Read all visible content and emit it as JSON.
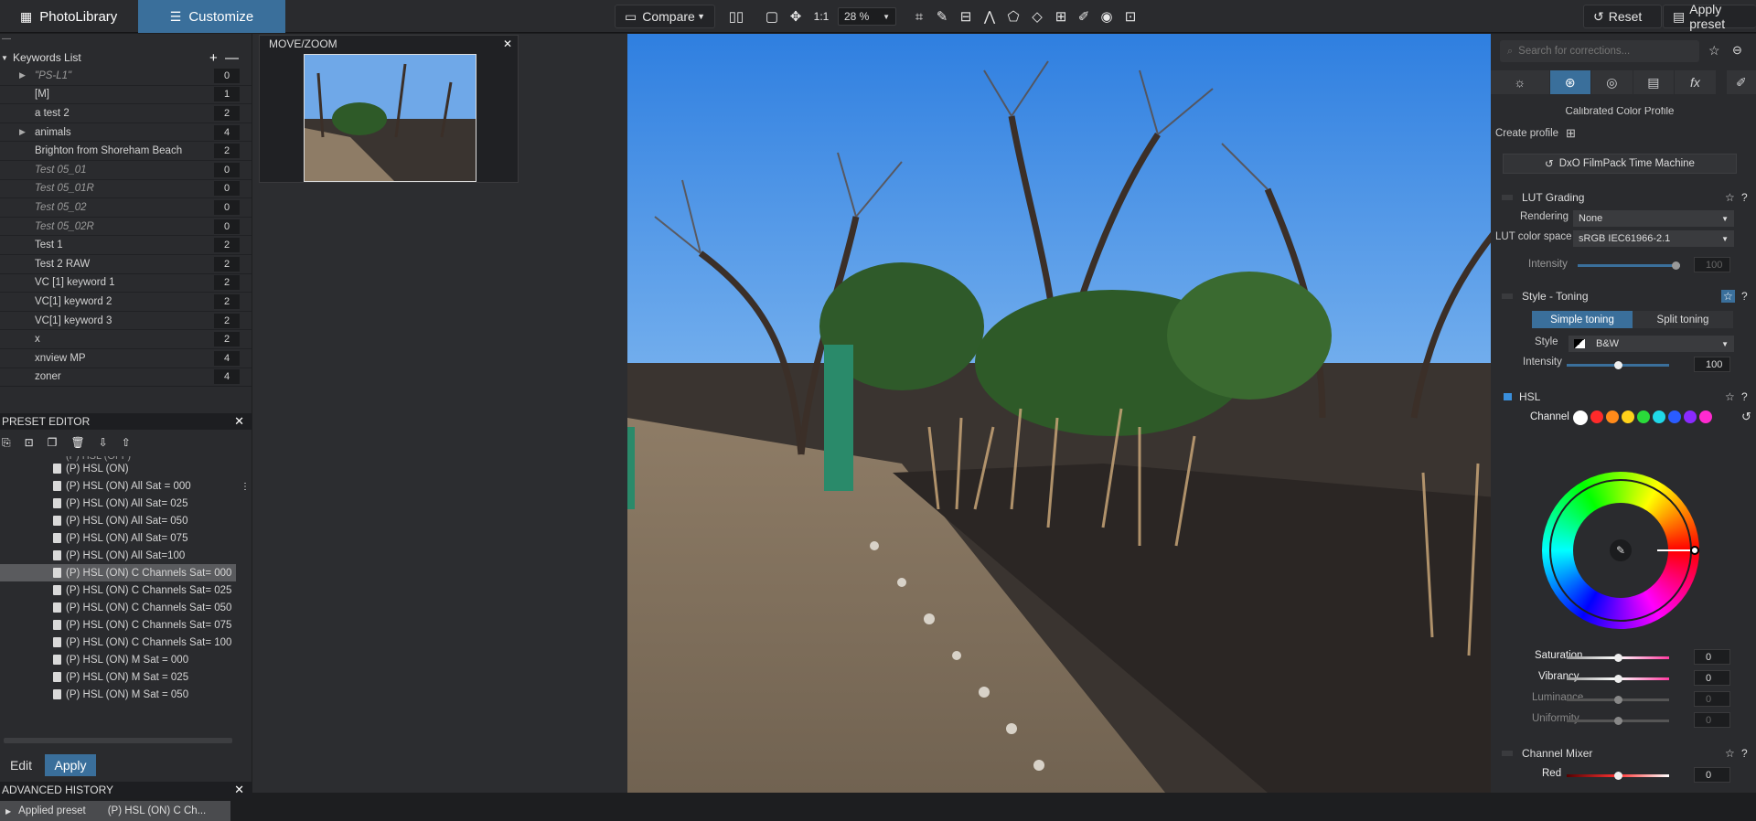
{
  "topbar": {
    "photolibrary": "PhotoLibrary",
    "customize": "Customize",
    "compare": "Compare",
    "one_to_one": "1:1",
    "zoom": "28 %",
    "reset": "Reset",
    "apply_preset": "Apply preset"
  },
  "keywords": {
    "title": "Keywords List",
    "items": [
      {
        "label": "\"PS-L1\"",
        "count": "0",
        "italic": true,
        "arrow": true
      },
      {
        "label": "[M]",
        "count": "1"
      },
      {
        "label": "a test 2",
        "count": "2"
      },
      {
        "label": "animals",
        "count": "4",
        "arrow": true
      },
      {
        "label": "Brighton from Shoreham Beach",
        "count": "2"
      },
      {
        "label": "Test 05_01",
        "count": "0",
        "italic": true
      },
      {
        "label": "Test 05_01R",
        "count": "0",
        "italic": true
      },
      {
        "label": "Test 05_02",
        "count": "0",
        "italic": true
      },
      {
        "label": "Test 05_02R",
        "count": "0",
        "italic": true
      },
      {
        "label": "Test 1",
        "count": "2"
      },
      {
        "label": "Test 2 RAW",
        "count": "2"
      },
      {
        "label": "VC [1] keyword 1",
        "count": "2"
      },
      {
        "label": "VC[1] keyword 2",
        "count": "2"
      },
      {
        "label": "VC[1] keyword 3",
        "count": "2"
      },
      {
        "label": "x",
        "count": "2"
      },
      {
        "label": "xnview MP",
        "count": "4"
      },
      {
        "label": "zoner",
        "count": "4"
      }
    ]
  },
  "preset_editor": {
    "title": "PRESET EDITOR",
    "items": [
      "(P) HSL (ON)",
      "(P) HSL (ON) All Sat = 000",
      "(P) HSL (ON) All Sat= 025",
      "(P) HSL (ON) All Sat= 050",
      "(P) HSL (ON) All Sat= 075",
      "(P) HSL (ON) All Sat=100",
      "(P) HSL (ON) C Channels Sat= 000",
      "(P) HSL (ON) C Channels Sat= 025",
      "(P) HSL (ON) C Channels Sat= 050",
      "(P) HSL (ON) C Channels Sat= 075",
      "(P) HSL (ON) C Channels Sat= 100",
      "(P) HSL (ON) M Sat = 000",
      "(P) HSL (ON) M Sat = 025",
      "(P) HSL (ON) M Sat = 050"
    ],
    "selected_index": 6,
    "edit": "Edit",
    "apply": "Apply"
  },
  "history": {
    "title": "ADVANCED HISTORY",
    "row_action": "Applied preset",
    "row_value": "(P) HSL (ON) C Ch..."
  },
  "movezoom": {
    "title": "MOVE/ZOOM"
  },
  "right": {
    "search_placeholder": "Search for corrections...",
    "calibrated": "Calibrated Color Profile",
    "create_profile": "Create profile",
    "filmpack": "DxO FilmPack Time Machine",
    "lut": {
      "title": "LUT Grading",
      "rendering_label": "Rendering",
      "rendering_value": "None",
      "colorspace_label": "LUT color space",
      "colorspace_value": "sRGB IEC61966-2.1",
      "intensity_label": "Intensity",
      "intensity_value": "100"
    },
    "toning": {
      "title": "Style - Toning",
      "simple": "Simple toning",
      "split": "Split toning",
      "style_label": "Style",
      "style_value": "B&W",
      "intensity_label": "Intensity",
      "intensity_value": "100"
    },
    "hsl": {
      "title": "HSL",
      "channel_label": "Channel",
      "channels": [
        "#ffffff",
        "#ff2a2a",
        "#ff8a1a",
        "#ffd21a",
        "#2adc3a",
        "#20d8e8",
        "#2a5cff",
        "#8a2aff",
        "#ff2ad0"
      ],
      "saturation_label": "Saturation",
      "saturation_value": "0",
      "vibrancy_label": "Vibrancy",
      "vibrancy_value": "0",
      "luminance_label": "Luminance",
      "luminance_value": "0",
      "uniformity_label": "Uniformity",
      "uniformity_value": "0"
    },
    "mixer": {
      "title": "Channel Mixer",
      "red_label": "Red",
      "red_value": "0"
    }
  }
}
